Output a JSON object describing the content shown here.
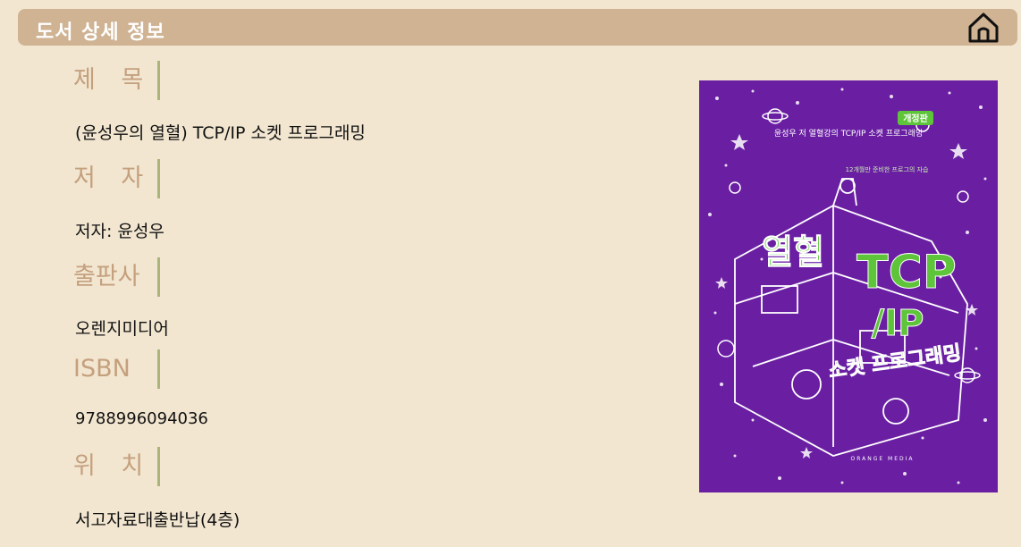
{
  "header": {
    "title": "도서 상세 정보",
    "home_icon": "home-icon"
  },
  "fields": [
    {
      "label": "제 목",
      "value": "(윤성우의 열혈) TCP/IP 소켓 프로그래밍"
    },
    {
      "label": "저 자",
      "value": "저자: 윤성우"
    },
    {
      "label": "출판사",
      "value": "오렌지미디어"
    },
    {
      "label": "ISBN",
      "value": "9788996094036"
    },
    {
      "label": "위 치",
      "value": "서고자료대출반납(4층)"
    }
  ],
  "cover": {
    "badge": "개정판",
    "subtitle": "윤성우 저 열혈강의 TCP/IP 소켓 프로그래밍",
    "tagline": "12개월만 준비한 프로그의 자습",
    "title_main": "열혈",
    "title_tcp": "TCP",
    "title_ip": "/IP",
    "title_sub": "소켓 프로그래밍",
    "publisher_mark": "ORANGE MEDIA",
    "colors": {
      "background": "#6a1fa3",
      "accent": "#5ec43a",
      "lineart": "#ffffff"
    }
  }
}
